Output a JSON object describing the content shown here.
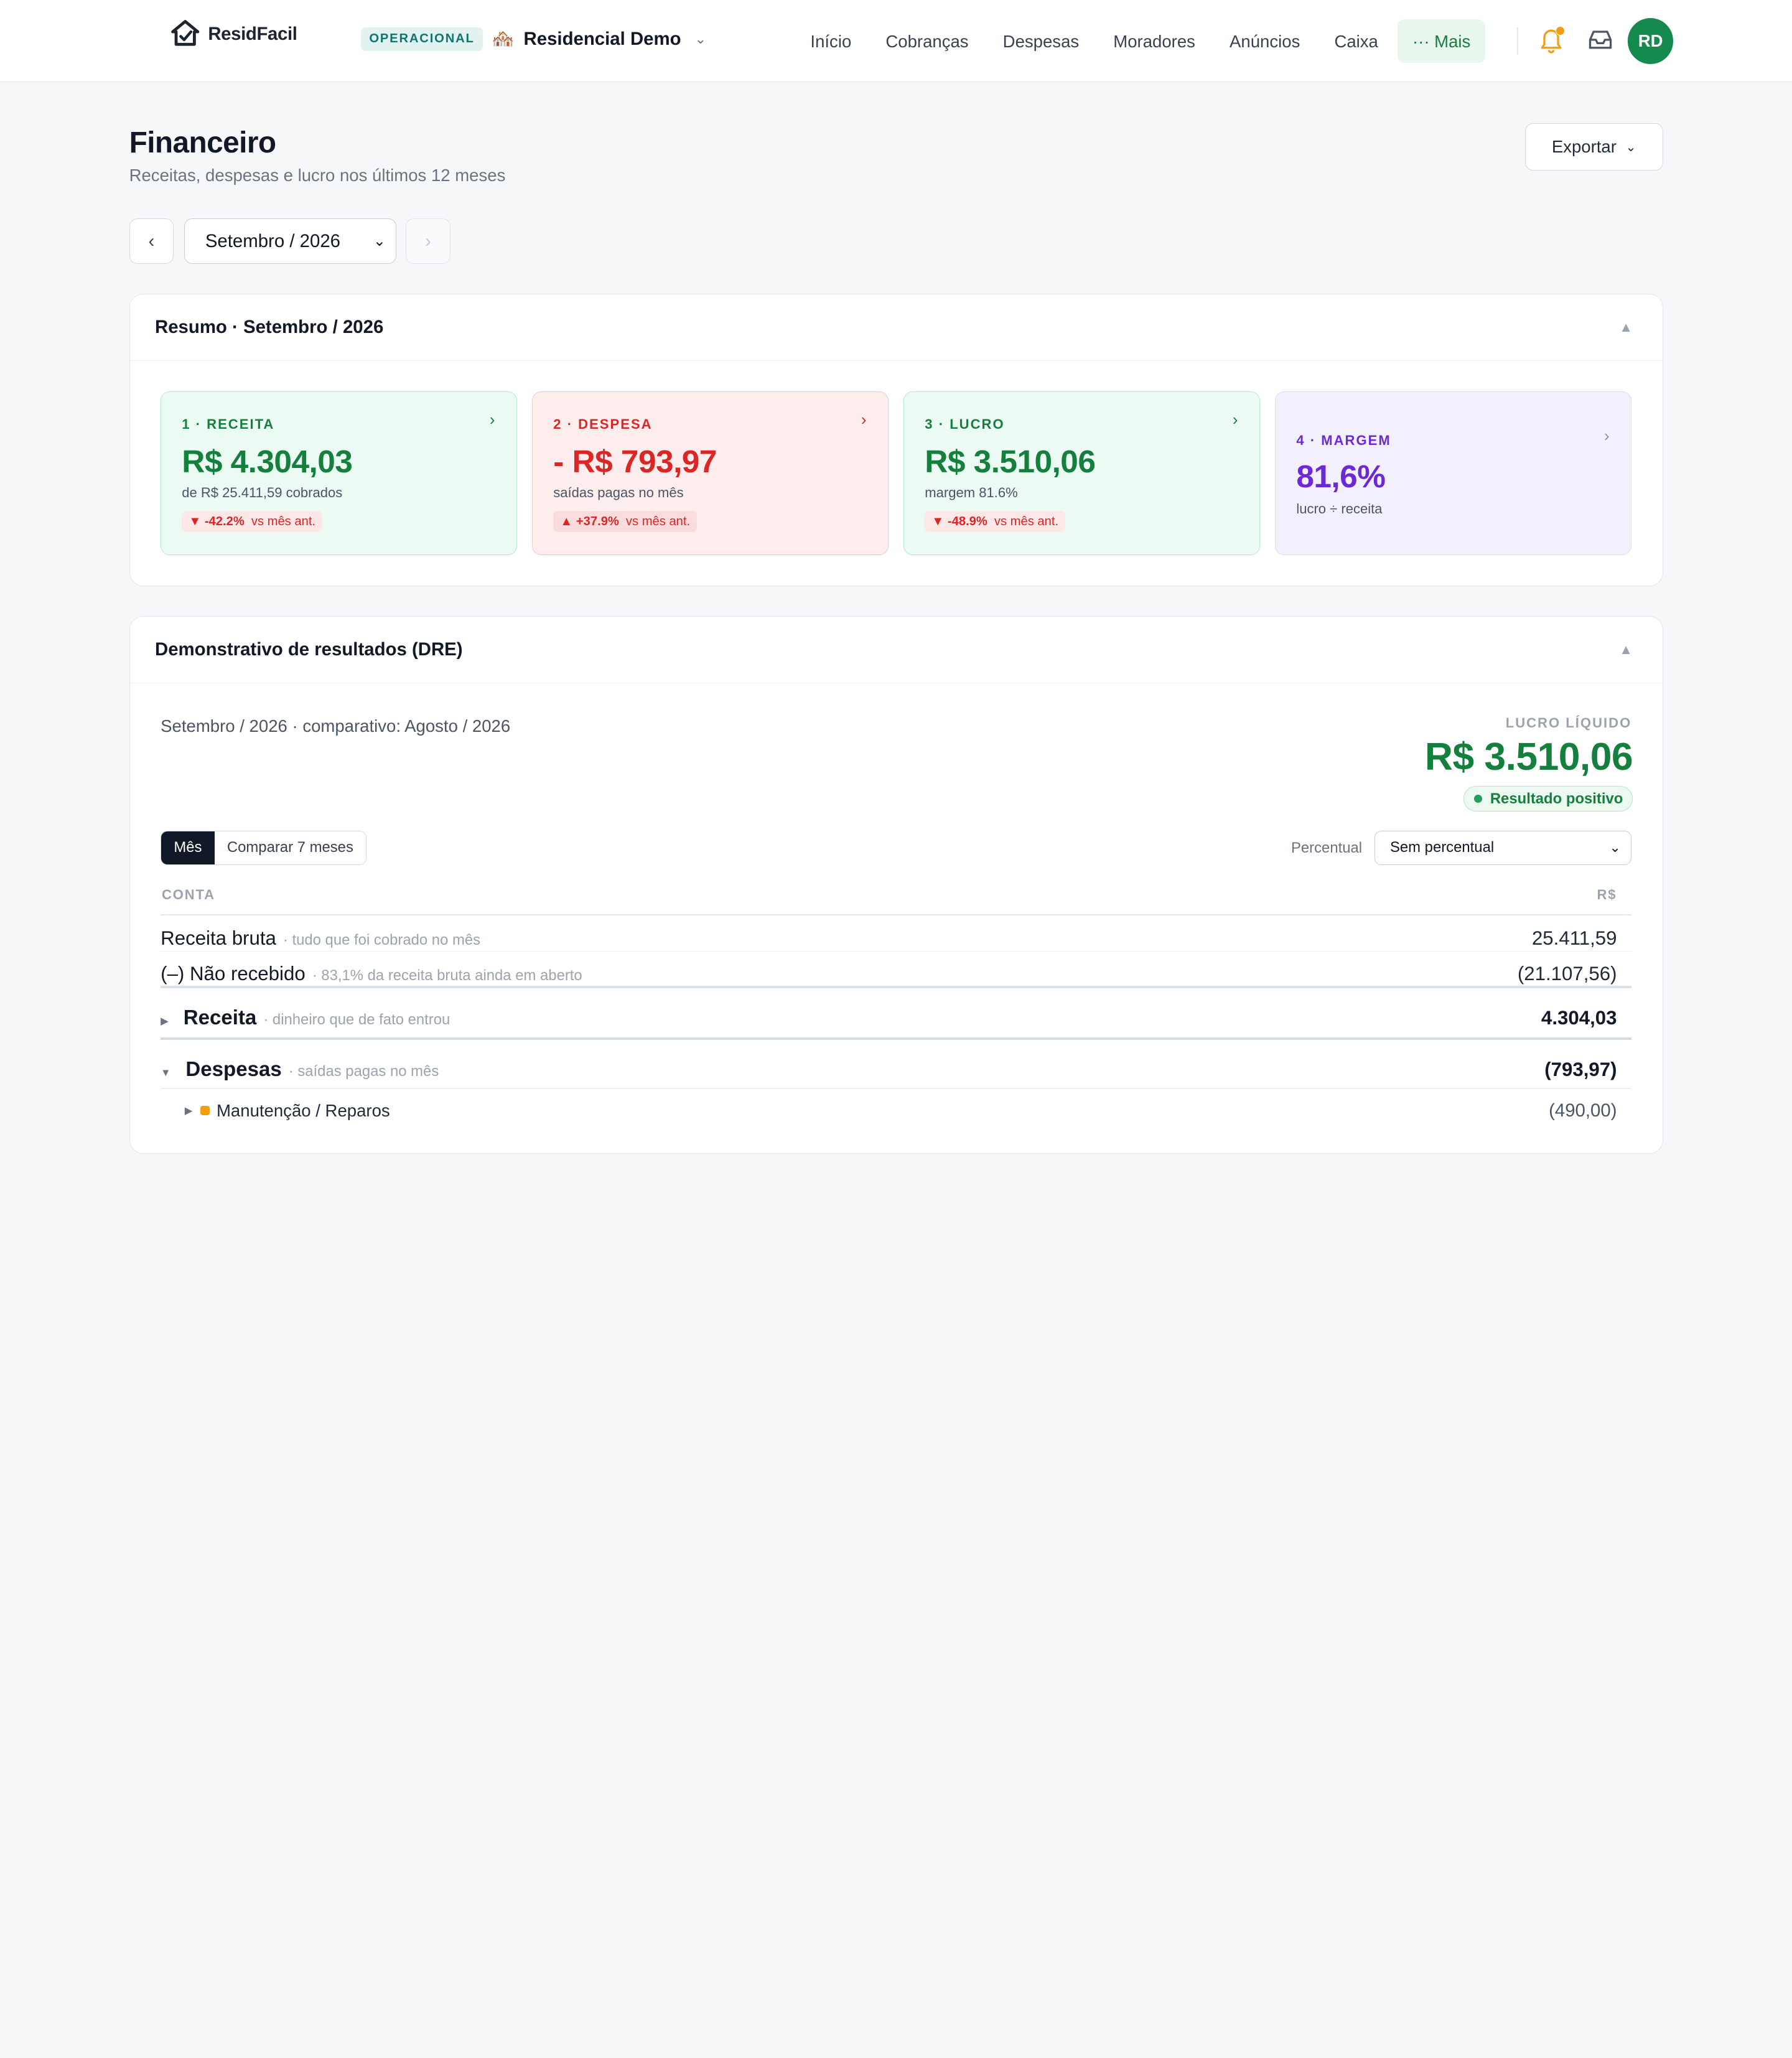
{
  "app": {
    "name": "ResidFacil"
  },
  "condo": {
    "status_badge": "OPERACIONAL",
    "emoji": "🏘️",
    "name": "Residencial Demo"
  },
  "nav": {
    "items": [
      "Início",
      "Cobranças",
      "Despesas",
      "Moradores",
      "Anúncios",
      "Caixa"
    ],
    "more": "··· Mais"
  },
  "user": {
    "initials": "RD"
  },
  "page": {
    "title": "Financeiro",
    "subtitle": "Receitas, despesas e lucro nos últimos 12 meses",
    "export_label": "Exportar",
    "period": "Setembro / 2026",
    "prev": "‹",
    "next": "›"
  },
  "summary": {
    "title": "Resumo · Setembro / 2026",
    "cards": [
      {
        "label": "1 · RECEITA",
        "value": "R$ 4.304,03",
        "sub": "de R$ 25.411,59 cobrados",
        "delta": "▼ -42.2%",
        "vs": "vs mês ant."
      },
      {
        "label": "2 · DESPESA",
        "value": "- R$ 793,97",
        "sub": "saídas pagas no mês",
        "delta": "▲ +37.9%",
        "vs": "vs mês ant."
      },
      {
        "label": "3 · LUCRO",
        "value": "R$ 3.510,06",
        "sub": "margem 81.6%",
        "delta": "▼ -48.9%",
        "vs": "vs mês ant."
      },
      {
        "label": "4 · MARGEM",
        "value": "81,6%",
        "sub": "lucro ÷ receita"
      }
    ]
  },
  "dre": {
    "title": "Demonstrativo de resultados (DRE)",
    "caption": "Setembro / 2026 · comparativo: Agosto / 2026",
    "net_label": "LUCRO LÍQUIDO",
    "net_value": "R$ 3.510,06",
    "result_badge": "Resultado positivo",
    "mode_month": "Mês",
    "mode_compare": "Comparar 7 meses",
    "pct_label": "Percentual",
    "pct_value": "Sem percentual",
    "col_account": "CONTA",
    "col_value": "R$",
    "rows": [
      {
        "name": "Receita bruta",
        "note": "· tudo que foi cobrado no mês",
        "value": "25.411,59"
      },
      {
        "name": "(–) Não recebido",
        "note": "· 83,1% da receita bruta ainda em aberto",
        "value": "(21.107,56)"
      },
      {
        "name": "Receita",
        "note": "· dinheiro que de fato entrou",
        "value": "4.304,03"
      },
      {
        "name": "Despesas",
        "note": "· saídas pagas no mês",
        "value": "(793,97)"
      },
      {
        "name": "Manutenção / Reparos",
        "value": "(490,00)"
      }
    ]
  },
  "colors": {
    "accent": "#15803d",
    "danger": "#dc2626",
    "purple": "#6d28d9"
  }
}
